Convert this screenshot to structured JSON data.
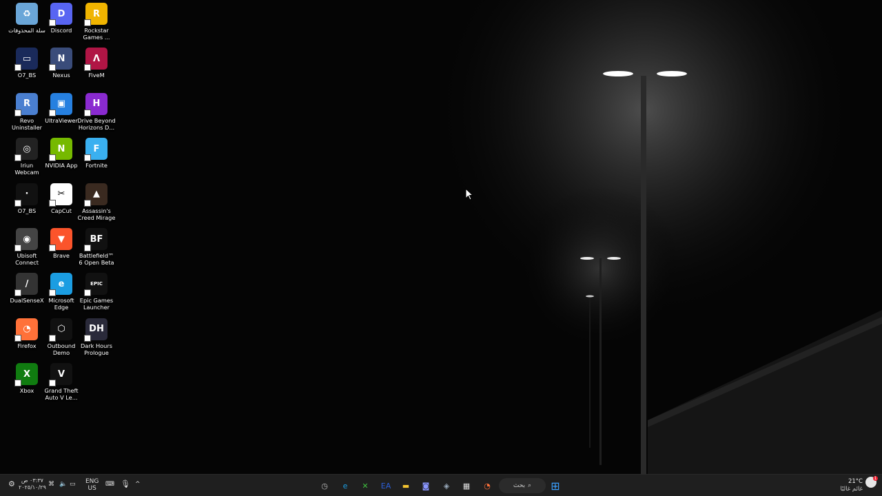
{
  "desktop": {
    "icons": [
      {
        "label": "سلة المحذوفات",
        "icon": "recycle-bin-icon",
        "color": "#6aa6d8"
      },
      {
        "label": "Discord",
        "icon": "discord-icon",
        "color": "#5865f2"
      },
      {
        "label": "Rockstar Games ...",
        "icon": "rockstar-icon",
        "color": "#f0b400"
      },
      {
        "label": "O7_BS",
        "icon": "o7bs-icon",
        "color": "#1a2a5a"
      },
      {
        "label": "Nexus",
        "icon": "nexus-icon",
        "color": "#3a4c7a"
      },
      {
        "label": "FiveM",
        "icon": "fivem-icon",
        "color": "#b01545"
      },
      {
        "label": "Revo Uninstaller",
        "icon": "revo-icon",
        "color": "#4a7fd0"
      },
      {
        "label": "UltraViewer",
        "icon": "ultraviewer-icon",
        "color": "#2680e0"
      },
      {
        "label": "Drive Beyond Horizons D...",
        "icon": "drive-beyond-icon",
        "color": "#8a2ad0"
      },
      {
        "label": "Iriun Webcam",
        "icon": "iriun-icon",
        "color": "#222"
      },
      {
        "label": "NVIDIA App",
        "icon": "nvidia-icon",
        "color": "#76b900"
      },
      {
        "label": "Fortnite",
        "icon": "fortnite-icon",
        "color": "#3ab0f0"
      },
      {
        "label": "O7_BS",
        "icon": "o7bs-file-icon",
        "color": "#111"
      },
      {
        "label": "CapCut",
        "icon": "capcut-icon",
        "color": "#fff"
      },
      {
        "label": "Assassin's Creed Mirage",
        "icon": "ac-mirage-icon",
        "color": "#3a2a20"
      },
      {
        "label": "Ubisoft Connect",
        "icon": "ubisoft-icon",
        "color": "#444"
      },
      {
        "label": "Brave",
        "icon": "brave-icon",
        "color": "#fb542b"
      },
      {
        "label": "Battlefield™ 6 Open Beta",
        "icon": "battlefield-icon",
        "color": "#111"
      },
      {
        "label": "DualSenseX",
        "icon": "dualsensex-icon",
        "color": "#333"
      },
      {
        "label": "Microsoft Edge",
        "icon": "edge-icon",
        "color": "#1b9de2"
      },
      {
        "label": "Epic Games Launcher",
        "icon": "epic-icon",
        "color": "#111"
      },
      {
        "label": "Firefox",
        "icon": "firefox-icon",
        "color": "#ff7139"
      },
      {
        "label": "Outbound Demo",
        "icon": "outbound-icon",
        "color": "#111"
      },
      {
        "label": "Dark Hours Prologue",
        "icon": "dark-hours-icon",
        "color": "#2a2a3a"
      },
      {
        "label": "Xbox",
        "icon": "xbox-icon",
        "color": "#107c10"
      },
      {
        "label": "Grand Theft Auto V Le...",
        "icon": "gta-icon",
        "color": "#111"
      }
    ],
    "glyphs": [
      "♻",
      "D",
      "R",
      "▭",
      "N",
      "Λ",
      "R",
      "▣",
      "H",
      "◎",
      "N",
      "F",
      "·",
      "✂",
      "▲",
      "◉",
      "▼",
      "BF",
      "/",
      "e",
      "EPIC",
      "◔",
      "⬡",
      "DH",
      "X",
      "V"
    ]
  },
  "taskbar": {
    "weather_temp": "21°C",
    "weather_text": "غائم غالبًا",
    "search_label": "بحث",
    "lang_top": "ENG",
    "lang_bottom": "US",
    "time": "٠٣:٣٧ ص",
    "date": "٢٠٢٥/١٠/٢٩",
    "apps": [
      {
        "name": "start-button",
        "glyph": "⊞",
        "color": "#3aa0ff"
      },
      {
        "name": "firefox-taskbar-icon",
        "glyph": "◔",
        "color": "#ff7139"
      },
      {
        "name": "ms-store-taskbar-icon",
        "glyph": "▦",
        "color": "#ddd"
      },
      {
        "name": "steam-taskbar-icon",
        "glyph": "◈",
        "color": "#9ab"
      },
      {
        "name": "discord-taskbar-icon",
        "glyph": "◙",
        "color": "#8a96ff"
      },
      {
        "name": "file-explorer-taskbar-icon",
        "glyph": "▬",
        "color": "#f4c430"
      },
      {
        "name": "ea-taskbar-icon",
        "glyph": "EA",
        "color": "#2c5fd8"
      },
      {
        "name": "xbox-taskbar-icon",
        "glyph": "✕",
        "color": "#3fbf3f"
      },
      {
        "name": "edge-taskbar-icon",
        "glyph": "e",
        "color": "#1b9de2"
      },
      {
        "name": "app-taskbar-icon",
        "glyph": "◷",
        "color": "#bbb"
      }
    ]
  }
}
